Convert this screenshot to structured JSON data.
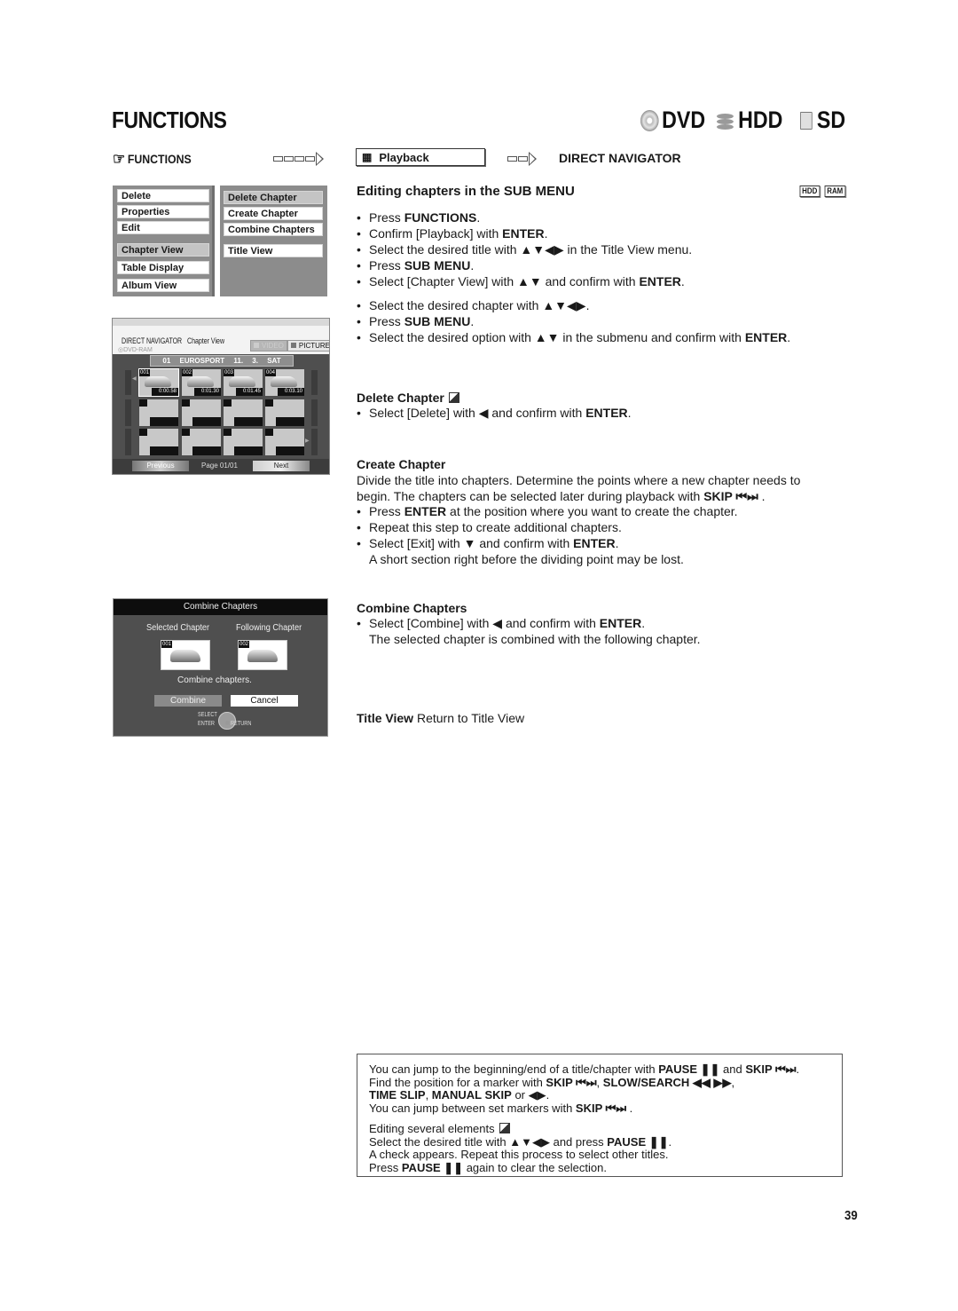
{
  "header": {
    "title": "FUNCTIONS",
    "media": [
      {
        "icon": "dvd-disc-icon",
        "label": "DVD"
      },
      {
        "icon": "hdd-stack-icon",
        "label": "HDD"
      },
      {
        "icon": "sd-card-icon",
        "label": "SD"
      }
    ]
  },
  "nav": {
    "functions_label": "FUNCTIONS",
    "hand_icon": "☞",
    "playback_label": "Playback",
    "playback_icon": "▦",
    "destination": "DIRECT NAVIGATOR"
  },
  "menus": {
    "left": [
      {
        "label": "Delete",
        "selected": false
      },
      {
        "label": "Properties",
        "selected": false
      },
      {
        "label": "Edit",
        "selected": false
      },
      {
        "label": "Chapter View",
        "selected": true
      },
      {
        "label": "Table Display",
        "selected": false
      },
      {
        "label": "Album View",
        "selected": false
      }
    ],
    "right": [
      {
        "label": "Delete Chapter",
        "selected": true
      },
      {
        "label": "Create Chapter",
        "selected": false
      },
      {
        "label": "Combine Chapters",
        "selected": false
      },
      {
        "label": "Title View",
        "selected": false
      }
    ]
  },
  "direct_navigator": {
    "title": "DIRECT NAVIGATOR",
    "view": "Chapter View",
    "media": "DVD-RAM",
    "tab_video": "VIDEO",
    "tab_picture": "PICTURE",
    "info_bar": "01 EUROSPORT 11. 3. SAT",
    "chapters": [
      {
        "num": "001",
        "time": "0:00.58",
        "selected": true
      },
      {
        "num": "002",
        "time": "0:01.30",
        "selected": false
      },
      {
        "num": "003",
        "time": "0:01.45",
        "selected": false
      },
      {
        "num": "004",
        "time": "0:03.10",
        "selected": false
      }
    ],
    "previous": "Previous",
    "page": "Page 01/01",
    "next": "Next"
  },
  "combine_dialog": {
    "title": "Combine Chapters",
    "selected_label": "Selected Chapter",
    "following_label": "Following Chapter",
    "selected_num": "001",
    "following_num": "002",
    "message": "Combine chapters.",
    "combine_btn": "Combine",
    "cancel_btn": "Cancel",
    "hint_select": "SELECT",
    "hint_enter": "ENTER",
    "hint_return": "RETURN"
  },
  "content": {
    "section_title": "Editing chapters in the SUB MENU",
    "badges": [
      "HDD",
      "RAM"
    ],
    "steps1": [
      [
        "Press ",
        "FUNCTIONS",
        "."
      ],
      [
        "Confirm [Playback] with ",
        "ENTER",
        "."
      ],
      [
        "Select the desired title with ▲▼◀▶ in the Title View menu.",
        "",
        ""
      ],
      [
        "Press ",
        "SUB MENU",
        "."
      ],
      [
        "Select [Chapter View] with ▲▼ and confirm with ",
        "ENTER",
        "."
      ]
    ],
    "steps2": [
      [
        "Select the desired chapter with ▲▼◀▶.",
        "",
        ""
      ],
      [
        "Press ",
        "SUB MENU",
        "."
      ],
      [
        "Select the desired option with ▲▼ in the submenu and confirm with ",
        "ENTER",
        "."
      ]
    ],
    "delete_heading": "Delete Chapter",
    "delete_steps": [
      [
        "Select [Delete] with ◀ and confirm with ",
        "ENTER",
        "."
      ]
    ],
    "create_heading": "Create Chapter",
    "create_intro_1": "Divide the title into chapters. Determine the points where a new chapter needs to",
    "create_intro_2a": "begin. The chapters can be selected later during playback with ",
    "create_intro_2b": "SKIP ⏮⏭",
    "create_intro_2c": " .",
    "create_steps": [
      [
        "Press ",
        "ENTER",
        " at the position where you want to create the chapter."
      ],
      [
        "Repeat this step to create additional chapters.",
        "",
        ""
      ],
      [
        "Select [Exit] with ▼ and confirm with ",
        "ENTER",
        "."
      ]
    ],
    "create_note": "A short section right before the dividing point may be lost.",
    "combine_heading": "Combine Chapters",
    "combine_steps": [
      [
        "Select [Combine] with ◀ and confirm with ",
        "ENTER",
        "."
      ]
    ],
    "combine_note": "The selected chapter is combined with the following chapter.",
    "title_view_bold": "Title View",
    "title_view_text": " Return to Title View"
  },
  "note_box": {
    "l1": [
      [
        "You can jump to the beginning/end of a title/chapter with ",
        false
      ],
      [
        "PAUSE ❚❚",
        true
      ],
      [
        " and ",
        false
      ],
      [
        "SKIP ⏮⏭",
        true
      ],
      [
        ".",
        false
      ]
    ],
    "l2": [
      [
        "Find the position for a marker with ",
        false
      ],
      [
        "SKIP ⏮⏭",
        true
      ],
      [
        ", ",
        false
      ],
      [
        "SLOW/SEARCH ◀◀ ▶▶",
        true
      ],
      [
        ",",
        false
      ]
    ],
    "l3": [
      [
        "TIME SLIP",
        true
      ],
      [
        ", ",
        false
      ],
      [
        "MANUAL SKIP",
        true
      ],
      [
        " or ◀▶.",
        false
      ]
    ],
    "l4": [
      [
        "You can jump between set markers with ",
        false
      ],
      [
        "SKIP ⏮⏭",
        true
      ],
      [
        " .",
        false
      ]
    ],
    "l5": [
      [
        "Editing several elements",
        false
      ]
    ],
    "l6": [
      [
        "Select the desired title with ▲▼◀▶ and press ",
        false
      ],
      [
        "PAUSE ❚❚",
        true
      ],
      [
        ".",
        false
      ]
    ],
    "l7": [
      [
        "A check appears. Repeat this process to select other titles.",
        false
      ]
    ],
    "l8": [
      [
        "Press ",
        false
      ],
      [
        "PAUSE ❚❚",
        true
      ],
      [
        " again to clear the selection.",
        false
      ]
    ]
  },
  "page_number": "39"
}
